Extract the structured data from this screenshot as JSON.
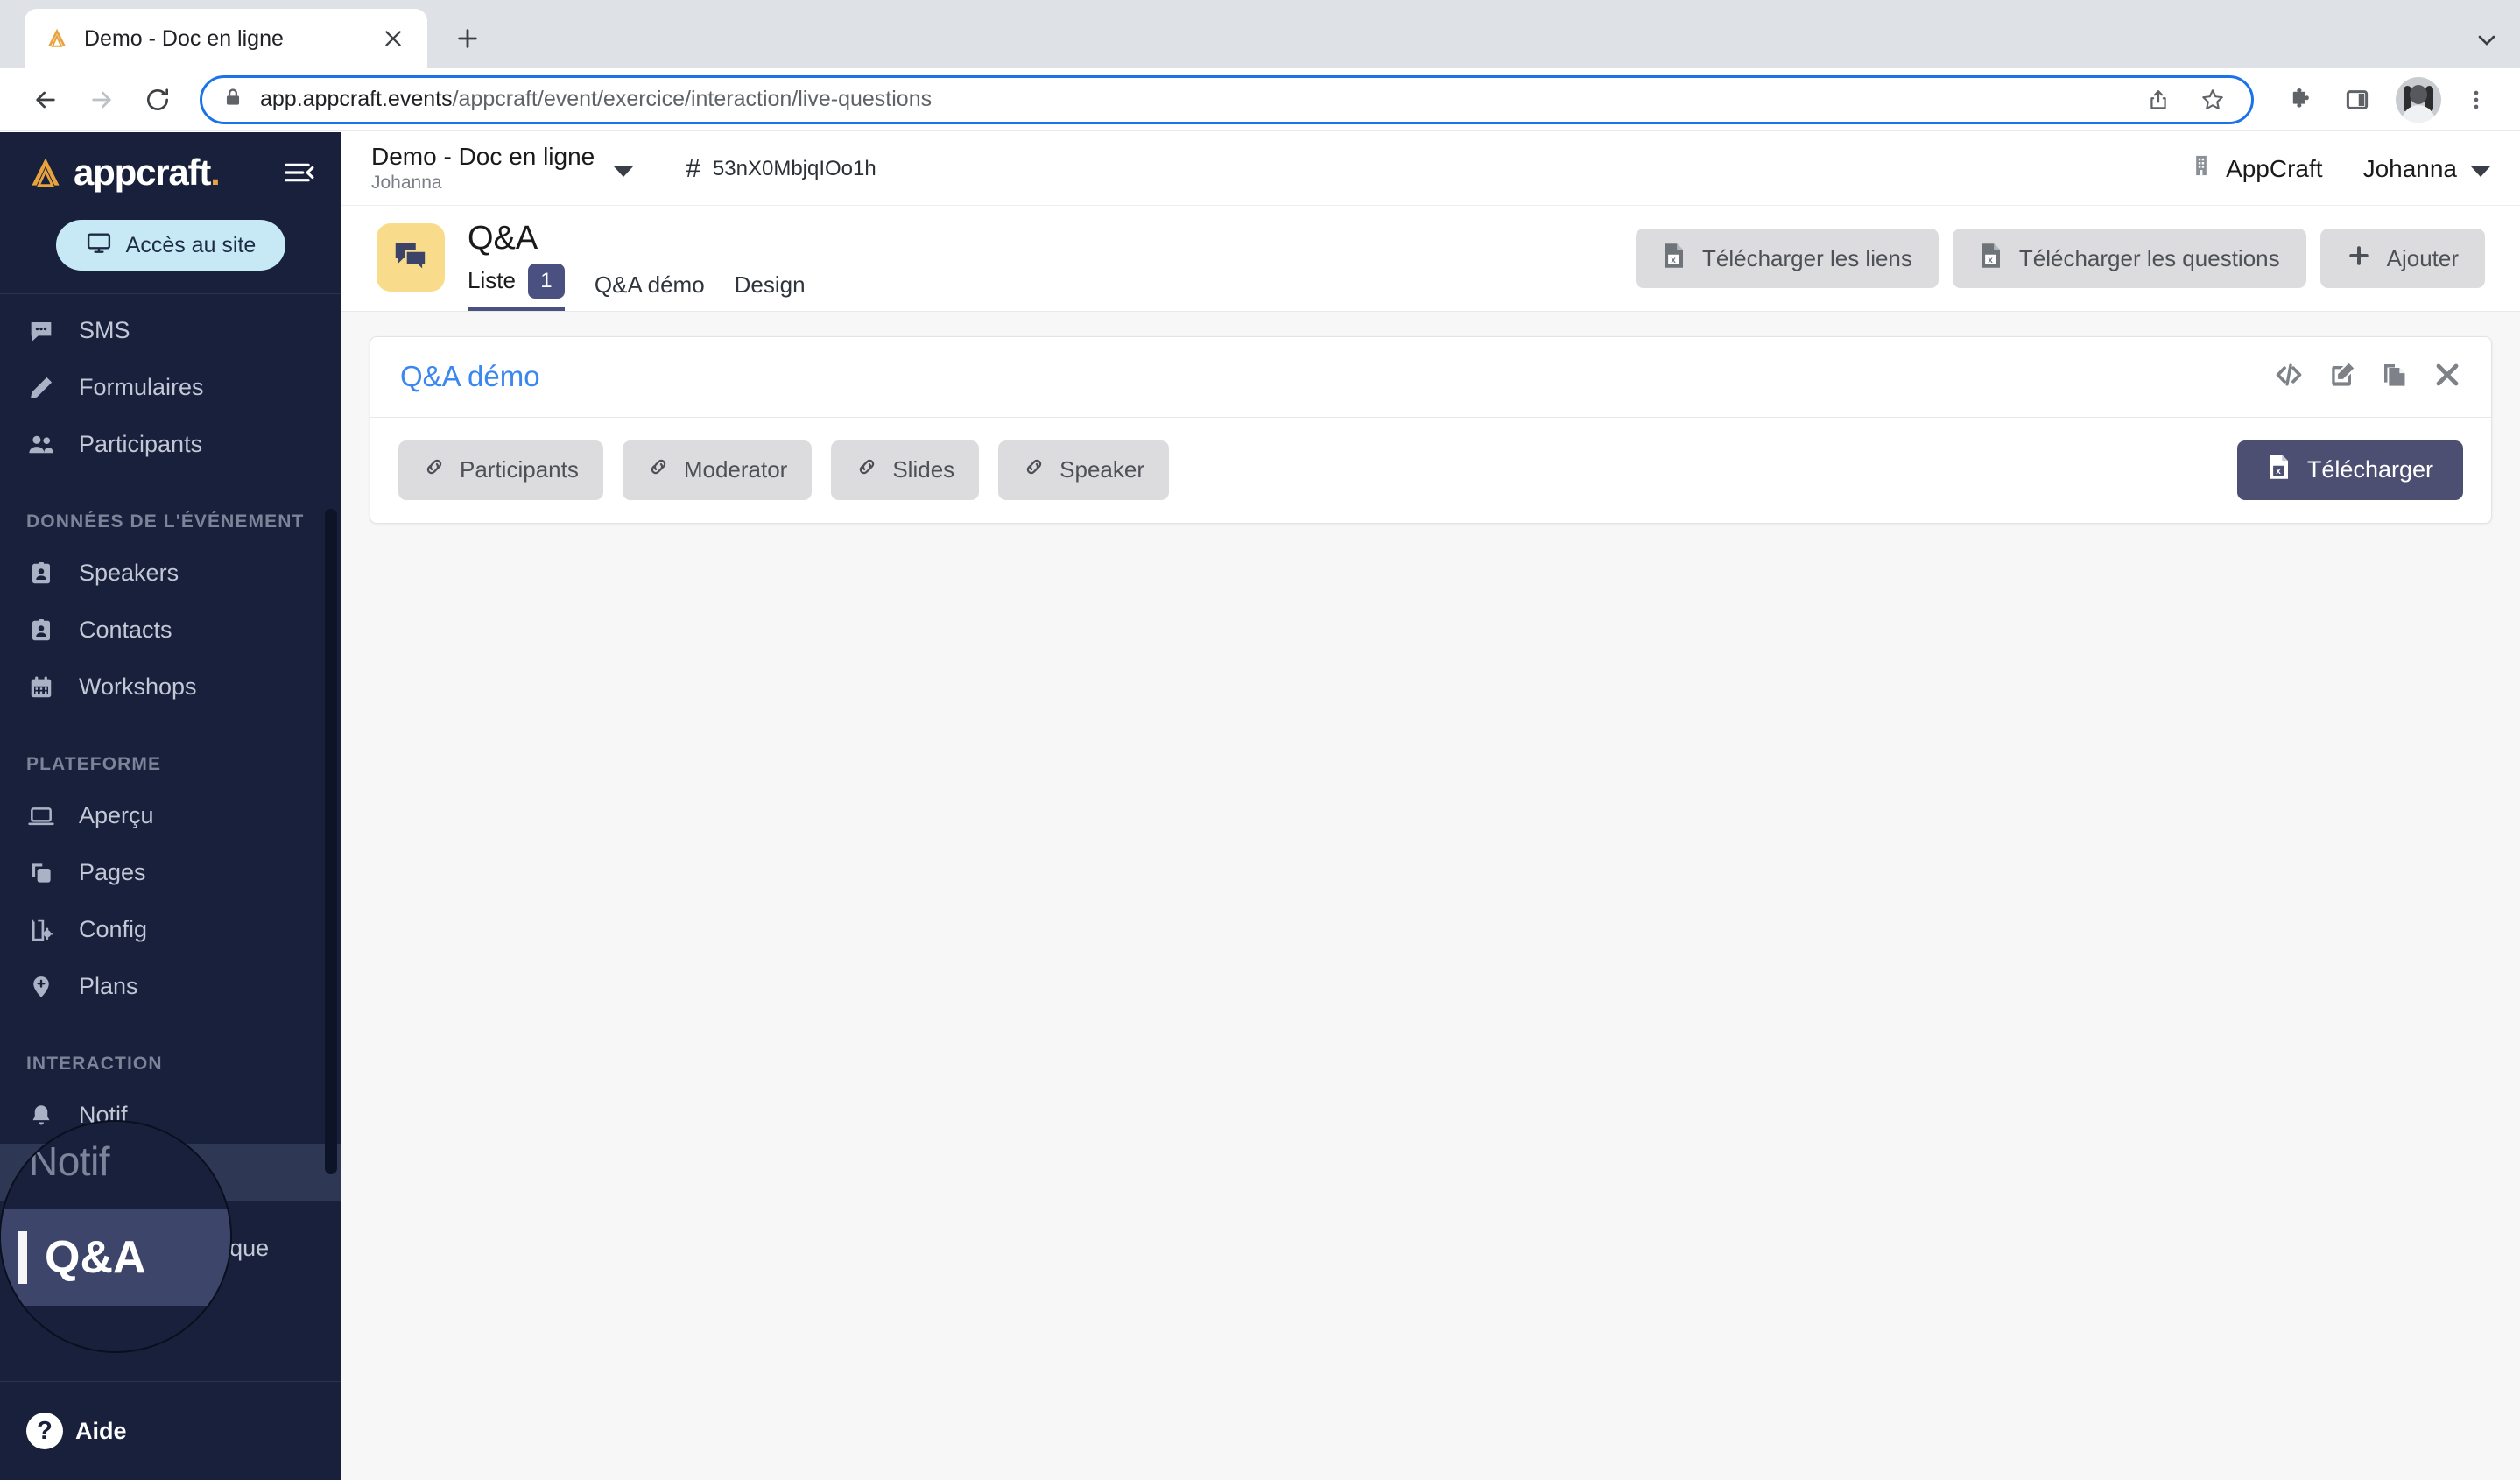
{
  "browser": {
    "tab": {
      "title": "Demo - Doc en ligne",
      "favicon": "appcraft-logo-icon",
      "close": "close-icon"
    },
    "new_tab": "new-tab-icon",
    "tabstrip_menu": "chevron-down-icon",
    "nav": {
      "back": "back-arrow-icon",
      "forward": "forward-arrow-icon",
      "reload": "reload-icon"
    },
    "url": {
      "lock": "lock-icon",
      "domain": "app.appcraft.events",
      "path": "/appcraft/event/exercice/interaction/live-questions",
      "share": "share-icon",
      "bookmark": "star-icon"
    },
    "toolbar": {
      "extensions": "puzzle-icon",
      "side_panel": "side-panel-icon",
      "profile": "avatar",
      "menu": "three-dot-menu-icon"
    }
  },
  "sidebar": {
    "brand": {
      "word": "appcraft",
      "dot": "."
    },
    "collapse": "collapse-sidebar-icon",
    "access_button": {
      "label": "Accès au site",
      "icon": "monitor-icon"
    },
    "items_top": [
      {
        "label": "SMS",
        "icon": "sms-bubble-icon"
      },
      {
        "label": "Formulaires",
        "icon": "pencil-icon"
      },
      {
        "label": "Participants",
        "icon": "people-icon"
      }
    ],
    "section_event": "DONNÉES DE L'ÉVÉNEMENT",
    "items_event": [
      {
        "label": "Speakers",
        "icon": "contact-card-icon"
      },
      {
        "label": "Contacts",
        "icon": "contact-card-icon"
      },
      {
        "label": "Workshops",
        "icon": "calendar-icon"
      }
    ],
    "section_platform": "PLATEFORME",
    "items_platform": [
      {
        "label": "Aperçu",
        "icon": "laptop-icon"
      },
      {
        "label": "Pages",
        "icon": "pages-icon"
      },
      {
        "label": "Config",
        "icon": "config-gear-icon"
      },
      {
        "label": "Plans",
        "icon": "map-pin-icon"
      }
    ],
    "section_interaction": "INTERACTION",
    "items_interaction": [
      {
        "label": "Notif",
        "icon": "bell-icon"
      },
      {
        "label": "Q&A",
        "icon": "qa-icon",
        "active": true
      }
    ],
    "items_tech": [
      {
        "label": "Param. Technique",
        "icon": "gear-icon"
      }
    ],
    "help": {
      "label": "Aide",
      "icon": "question-mark-icon"
    }
  },
  "magnifier": {
    "behind_label": "Notif",
    "focus_label": "Q&A"
  },
  "topbar": {
    "event_name": "Demo - Doc en ligne",
    "event_owner": "Johanna",
    "event_dropdown": "chevron-down-icon",
    "hash": "#",
    "event_code": "53nX0MbjqIOo1h",
    "org_icon": "building-icon",
    "org_name": "AppCraft",
    "user_name": "Johanna",
    "user_dropdown": "chevron-down-icon"
  },
  "page": {
    "icon": "qa-chat-icon",
    "title": "Q&A",
    "tabs": [
      {
        "label": "Liste",
        "badge": "1",
        "active": true
      },
      {
        "label": "Q&A démo",
        "active": false
      },
      {
        "label": "Design",
        "active": false
      }
    ],
    "actions": [
      {
        "label": "Télécharger les liens",
        "icon": "excel-file-icon"
      },
      {
        "label": "Télécharger les questions",
        "icon": "excel-file-icon"
      },
      {
        "label": "Ajouter",
        "icon": "plus-icon"
      }
    ]
  },
  "card": {
    "title": "Q&A démo",
    "icons": [
      {
        "name": "code-icon"
      },
      {
        "name": "edit-icon"
      },
      {
        "name": "duplicate-icon"
      },
      {
        "name": "close-icon"
      }
    ],
    "links": [
      {
        "label": "Participants",
        "icon": "link-icon"
      },
      {
        "label": "Moderator",
        "icon": "link-icon"
      },
      {
        "label": "Slides",
        "icon": "link-icon"
      },
      {
        "label": "Speaker",
        "icon": "link-icon"
      }
    ],
    "download": {
      "label": "Télécharger",
      "icon": "excel-file-icon"
    }
  },
  "colors": {
    "sidebar_bg": "#18203c",
    "sidebar_active": "#2e3754",
    "accent_blue": "#3b87f0",
    "badge_purple": "#4a5080",
    "download_purple": "#4c4f72",
    "qa_icon_yellow": "#f8dc8c",
    "access_pill": "#c7e9f5",
    "page_bg": "#f7f7f8"
  }
}
